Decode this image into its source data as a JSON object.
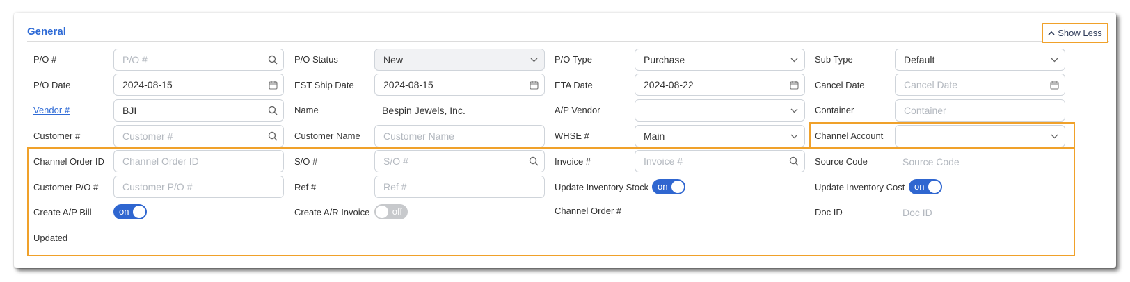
{
  "section": {
    "title": "General",
    "show_less": "Show Less"
  },
  "row1": {
    "po_num": {
      "label": "P/O #",
      "placeholder": "P/O #"
    },
    "po_status": {
      "label": "P/O Status",
      "value": "New"
    },
    "po_type": {
      "label": "P/O Type",
      "value": "Purchase"
    },
    "sub_type": {
      "label": "Sub Type",
      "value": "Default"
    }
  },
  "row2": {
    "po_date": {
      "label": "P/O Date",
      "value": "2024-08-15"
    },
    "est_ship_date": {
      "label": "EST Ship Date",
      "value": "2024-08-15"
    },
    "eta_date": {
      "label": "ETA Date",
      "value": "2024-08-22"
    },
    "cancel_date": {
      "label": "Cancel Date",
      "placeholder": "Cancel Date"
    }
  },
  "row3": {
    "vendor_num": {
      "label": "Vendor #",
      "value": "BJI"
    },
    "name": {
      "label": "Name",
      "value": "Bespin Jewels, Inc."
    },
    "ap_vendor": {
      "label": "A/P Vendor",
      "value": ""
    },
    "container": {
      "label": "Container",
      "placeholder": "Container"
    }
  },
  "row4": {
    "customer_num": {
      "label": "Customer #",
      "placeholder": "Customer #"
    },
    "customer_name": {
      "label": "Customer Name",
      "placeholder": "Customer Name"
    },
    "whse_num": {
      "label": "WHSE #",
      "value": "Main"
    },
    "channel_account": {
      "label": "Channel Account",
      "value": ""
    }
  },
  "row5": {
    "channel_order_id": {
      "label": "Channel Order ID",
      "placeholder": "Channel Order ID"
    },
    "so_num": {
      "label": "S/O #",
      "placeholder": "S/O #"
    },
    "invoice_num": {
      "label": "Invoice #",
      "placeholder": "Invoice #"
    },
    "source_code": {
      "label": "Source Code",
      "placeholder": "Source Code"
    }
  },
  "row6": {
    "customer_po": {
      "label": "Customer P/O #",
      "placeholder": "Customer P/O #"
    },
    "ref_num": {
      "label": "Ref #",
      "placeholder": "Ref #"
    },
    "update_inventory_stock": {
      "label": "Update Inventory Stock",
      "state": "on"
    },
    "update_inventory_cost": {
      "label": "Update Inventory Cost",
      "state": "on"
    }
  },
  "row7": {
    "create_ap_bill": {
      "label": "Create A/P Bill",
      "state": "on"
    },
    "create_ar_invoice": {
      "label": "Create A/R Invoice",
      "state": "off"
    },
    "channel_order_num": {
      "label": "Channel Order #"
    },
    "doc_id": {
      "label": "Doc ID",
      "placeholder": "Doc ID"
    }
  },
  "row8": {
    "updated": {
      "label": "Updated"
    }
  },
  "colors": {
    "accent": "#2f6bd6",
    "toggle_on": "#2f66d0",
    "highlight": "#f0a12a"
  },
  "icons": {
    "search": "search-icon",
    "chevron": "chevron-down-icon",
    "calendar": "calendar-icon",
    "collapse": "chevron-up-icon"
  }
}
